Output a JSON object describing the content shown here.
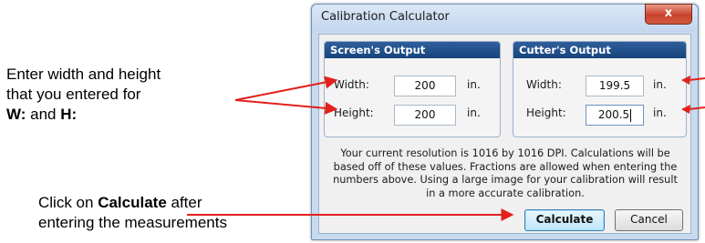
{
  "annotations": {
    "enter_line1": "Enter width and height",
    "enter_line2": "that you entered for",
    "enter_w": "W:",
    "enter_and": " and ",
    "enter_h": "H:",
    "click_prefix": "Click on ",
    "click_bold": "Calculate",
    "click_suffix": " after",
    "click_line2": "entering the measurements",
    "arrow_color": "#e3211c"
  },
  "dialog": {
    "title": "Calibration Calculator",
    "close_glyph": "x",
    "screen_group": {
      "header": "Screen's Output",
      "width_label": "Width:",
      "width_value": "200",
      "width_unit": "in.",
      "height_label": "Height:",
      "height_value": "200",
      "height_unit": "in."
    },
    "cutter_group": {
      "header": "Cutter's Output",
      "width_label": "Width:",
      "width_value": "199.5",
      "width_unit": "in.",
      "height_label": "Height:",
      "height_value": "200.5",
      "height_unit": "in."
    },
    "info_text": "Your current resolution is 1016 by 1016 DPI. Calculations will be based off of these values. Fractions are allowed when entering the numbers above. Using a large image for your calibration will result in a more accurate calibration.",
    "calculate_label": "Calculate",
    "cancel_label": "Cancel"
  }
}
